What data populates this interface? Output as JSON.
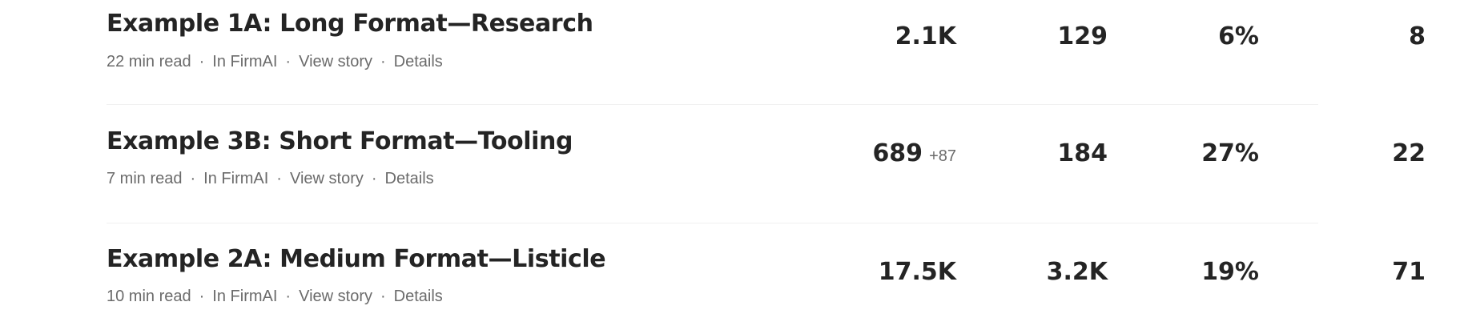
{
  "stories": [
    {
      "title": "Example 1A: Long Format—Research",
      "read_time": "22 min read",
      "publication": "In FirmAI",
      "view_story_label": "View story",
      "details_label": "Details",
      "views": "2.1K",
      "views_delta": "",
      "reads": "129",
      "read_ratio": "6%",
      "fans": "8"
    },
    {
      "title": "Example 3B: Short Format—Tooling",
      "read_time": "7 min read",
      "publication": "In FirmAI",
      "view_story_label": "View story",
      "details_label": "Details",
      "views": "689",
      "views_delta": "+87",
      "reads": "184",
      "read_ratio": "27%",
      "fans": "22"
    },
    {
      "title": "Example 2A: Medium Format—Listicle",
      "read_time": "10 min read",
      "publication": "In FirmAI",
      "view_story_label": "View story",
      "details_label": "Details",
      "views": "17.5K",
      "views_delta": "",
      "reads": "3.2K",
      "read_ratio": "19%",
      "fans": "71"
    }
  ],
  "meta_separator": "·"
}
